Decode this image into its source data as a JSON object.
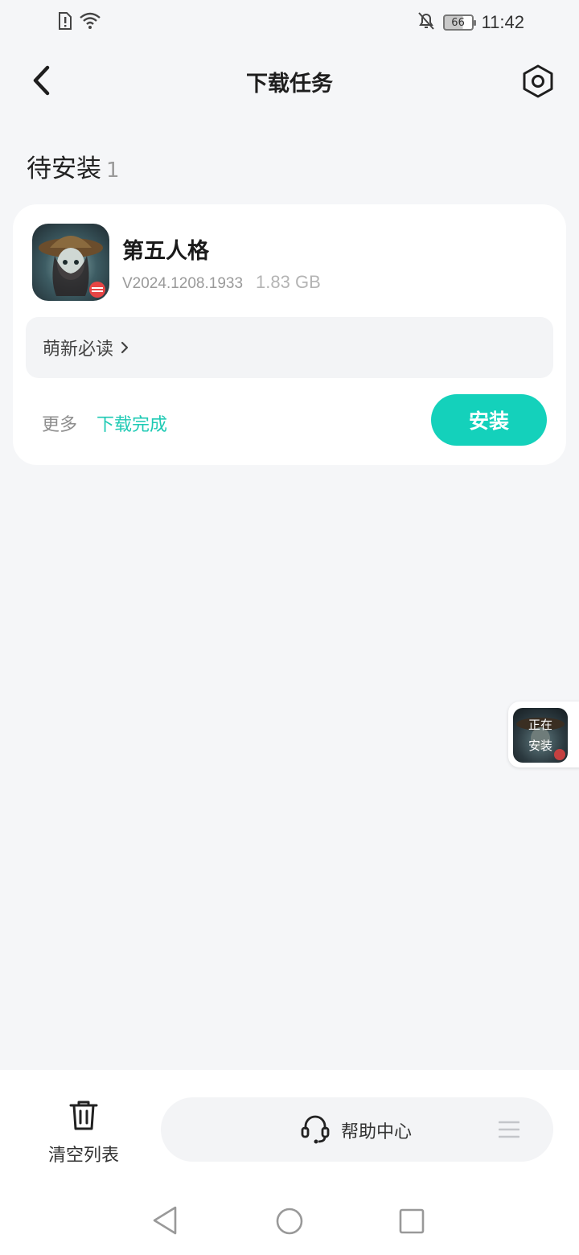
{
  "status_bar": {
    "time": "11:42",
    "battery": "66",
    "icons": [
      "sim-alert-icon",
      "wifi-icon",
      "bell-muted-icon",
      "battery-icon"
    ]
  },
  "header": {
    "title": "下载任务",
    "back_icon": "chevron-left-icon",
    "settings_icon": "hexagon-settings-icon"
  },
  "section": {
    "title": "待安装",
    "count": "1"
  },
  "task_card": {
    "app_name": "第五人格",
    "version": "V2024.1208.1933",
    "size": "1.83 GB",
    "guide_label": "萌新必读",
    "more_label": "更多",
    "status": "下载完成",
    "install_button": "安装",
    "accent_color": "#14d1bb"
  },
  "floating_widget": {
    "line1": "正在",
    "line2": "安装"
  },
  "bottom_bar": {
    "clear_label": "清空列表",
    "help_label": "帮助中心"
  }
}
